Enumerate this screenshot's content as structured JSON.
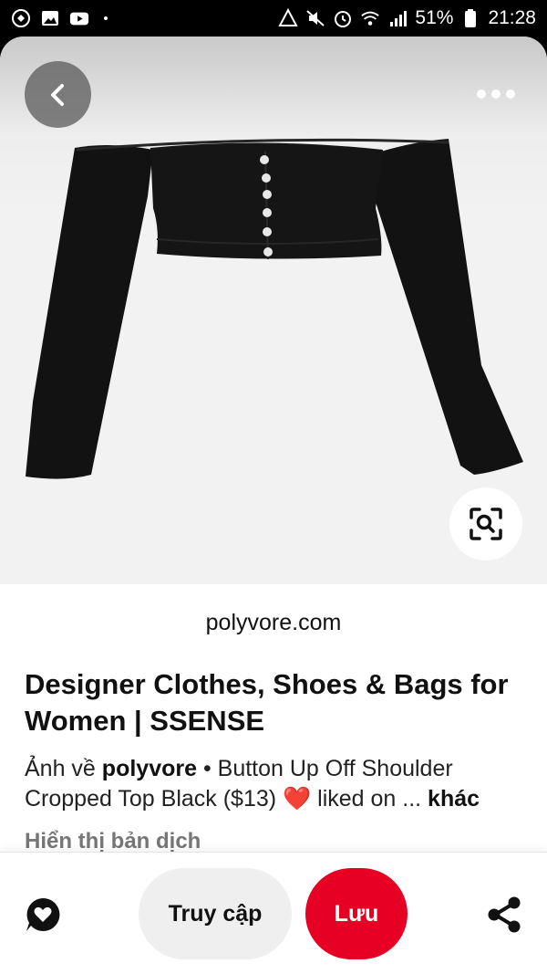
{
  "status_bar": {
    "battery": "51%",
    "time": "21:28"
  },
  "pin": {
    "source_domain": "polyvore.com",
    "title": "Designer Clothes, Shoes & Bags for Women | SSENSE",
    "desc_prefix": "Ảnh về",
    "desc_author": "polyvore",
    "desc_text": "• Button Up Off Shoulder Cropped Top Black ($13)",
    "desc_heart": "❤️",
    "desc_suffix": "liked on ...",
    "more_label": "khác",
    "translate_label": "Hiển thị bản dịch"
  },
  "actions": {
    "visit_label": "Truy cập",
    "save_label": "Lưu"
  },
  "icons": {
    "back": "chevron-left-icon",
    "more": "more-horizontal-icon",
    "visual_search": "lens-search-icon",
    "comment": "comment-heart-icon",
    "share": "share-icon"
  },
  "colors": {
    "brand_red": "#e60023",
    "visit_bg": "#efefef"
  }
}
